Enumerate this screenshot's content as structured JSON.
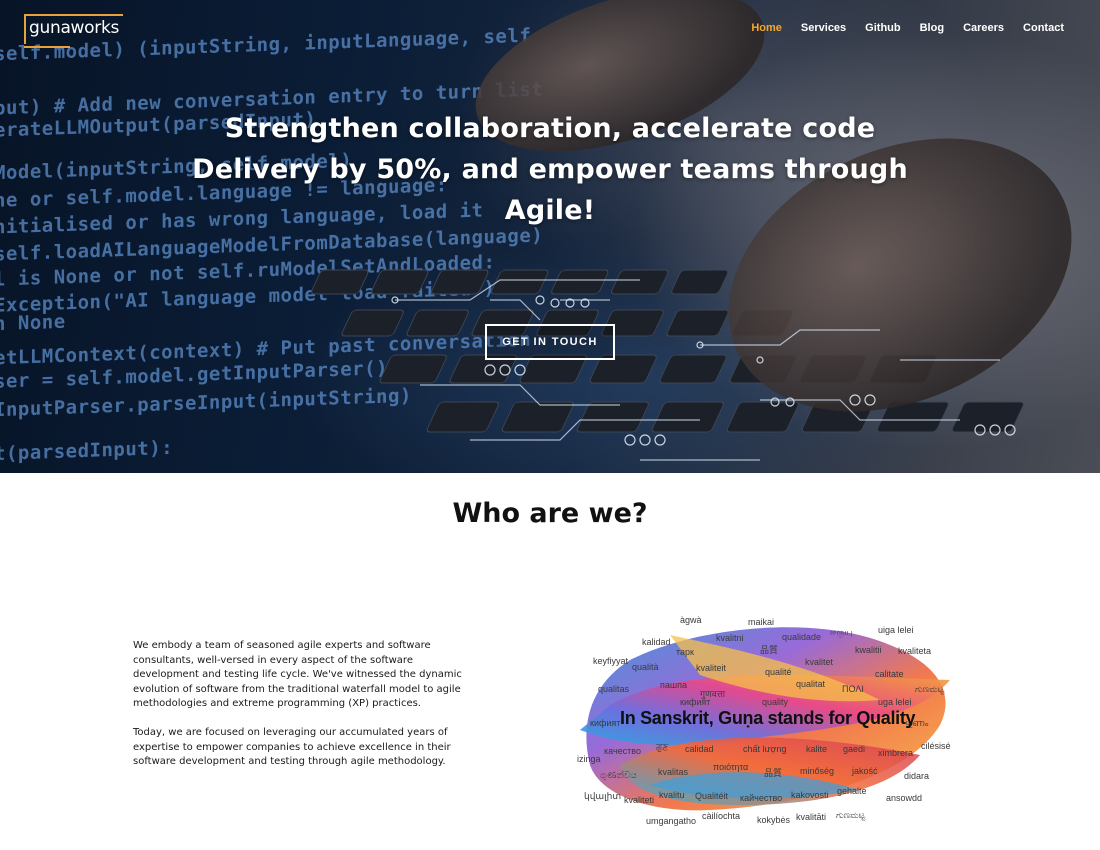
{
  "brand": {
    "logo_text": "gunaworks",
    "accent": "#f3a82f"
  },
  "nav": {
    "items": [
      {
        "label": "Home",
        "active": true
      },
      {
        "label": "Services",
        "active": false
      },
      {
        "label": "Github",
        "active": false
      },
      {
        "label": "Blog",
        "active": false
      },
      {
        "label": "Careers",
        "active": false
      },
      {
        "label": "Contact",
        "active": false
      }
    ]
  },
  "hero": {
    "headline_line1": "Strengthen collaboration, accelerate code",
    "headline_line2": "Delivery by 50%, and empower teams through",
    "headline_line3": "Agile!",
    "cta_label": "GET IN TOUCH",
    "background_code": [
      "self.model) (inputString, inputLanguage, self",
      "put) # Add new conversation entry to turn list",
      "erateLLMOutput(parsedInput)",
      "Model(inputString, self.model)",
      "ne or self.model.language != language:",
      "nitialised or has wrong language, load it",
      "self.loadAILanguageModelFromDatabase(language)",
      "l is None or not self.ruModelSetAndLoaded:",
      "Exception(\"AI language model load failed\")",
      "n None",
      "etLLMContext(context) # Put past conversation",
      "ser = self.model.getInputParser()",
      "InputParser.parseInput(inputString)",
      "t(parsedInput):"
    ]
  },
  "about": {
    "title": "Who are we?",
    "paragraph1": "We embody a team of seasoned agile experts and software consultants, well-versed in every aspect of the software development and testing life cycle. We've witnessed the dynamic evolution of software from the traditional waterfall model to agile methodologies and extreme programming (XP) practices.",
    "paragraph2": "Today, we are focused on leveraging our accumulated years of expertise to empower companies to achieve excellence in their software development and testing through agile methodology."
  },
  "wordcloud": {
    "title": "In Sanskrit, Guṇa stands for Quality",
    "words": [
      "àgwà",
      "maikai",
      "ஈருயு",
      "uiga lelei",
      "kalidad",
      "kvalitni",
      "qualidade",
      "kwalitii",
      "keyfiyyat",
      "тарк",
      "品質",
      "kvalitet",
      "kvaliteta",
      "qualità",
      "kvaliteit",
      "qualité",
      "calitate",
      "qualitas",
      "пашпа",
      "गुणवत्ता",
      "qualitat",
      "ΠΟΛΙ",
      "ಗುಣಮಟ್ಟ",
      "кифият",
      "quality",
      "uga lelei",
      "ഗുണം",
      "кифият",
      "качество",
      "ਗੁਣ",
      "calidad",
      "chất lượng",
      "kalite",
      "gaedi",
      "ximbrera",
      "cilésisé",
      "izinga",
      "ගුණත්වය",
      "kvalitas",
      "ποιότητα",
      "品質",
      "minőség",
      "jakość",
      "didara",
      "կվալիտ",
      "kvaliteti",
      "kvalitu",
      "Qualitéit",
      "кайчество",
      "kakovosti",
      "gehalte",
      "ansowdd",
      "umgangatho",
      "càilíochta",
      "kokybės",
      "kvalitāti",
      "ಗುಣಮಟ್ಟ"
    ]
  }
}
